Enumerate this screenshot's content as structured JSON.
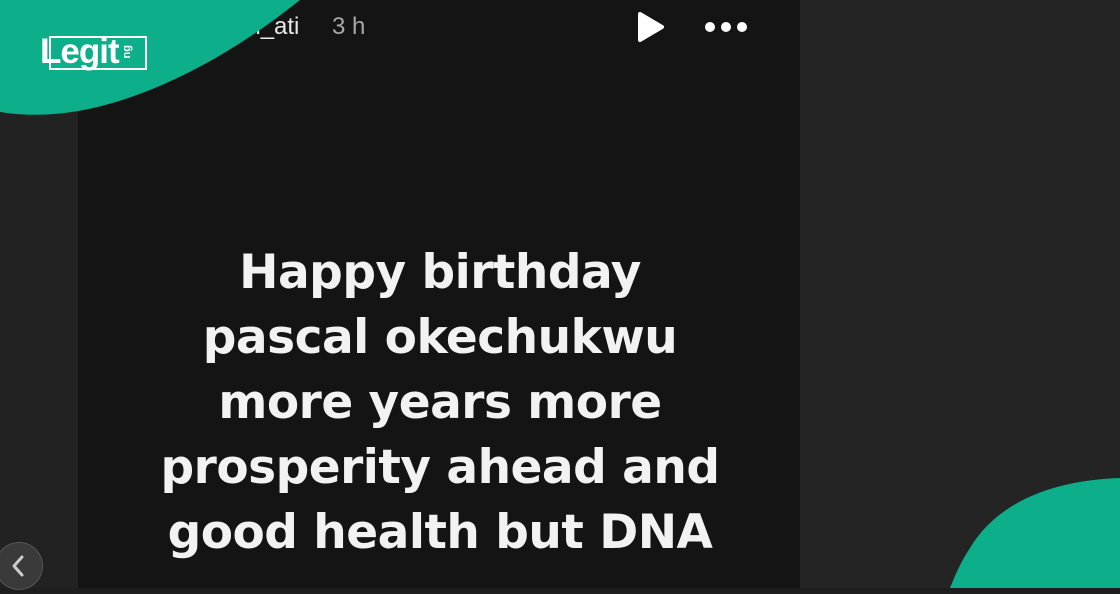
{
  "story": {
    "username": "en_ati",
    "timestamp": "3 h",
    "text_lines": [
      "Happy birthday",
      "pascal okechukwu",
      "more years more",
      "prosperity ahead and",
      "good health but DNA"
    ]
  },
  "controls": {
    "play_icon": "play-icon",
    "more_icon": "more-options-icon",
    "prev_icon": "chevron-left-icon"
  },
  "branding": {
    "logo_word": "Legit",
    "logo_tld": "ng",
    "color": "#0dae8a"
  },
  "colors": {
    "page_bg": "#1e1e1e",
    "story_bg": "#141414",
    "text": "#f2f2f2",
    "meta_text": "#a8a8a8"
  }
}
